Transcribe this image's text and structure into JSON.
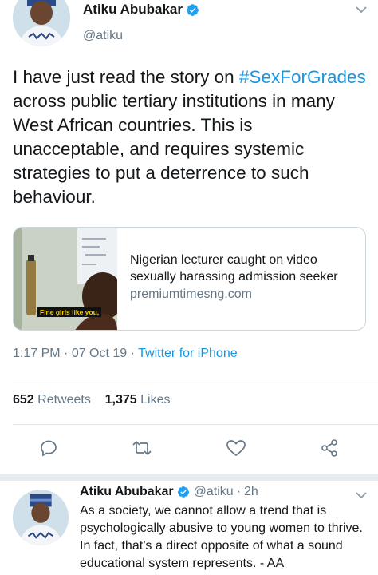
{
  "tweet": {
    "author_name": "Atiku Abubakar",
    "author_handle": "@atiku",
    "text_before": "I have just read the story on ",
    "hashtag": "#SexForGrades",
    "text_after": " across public tertiary institutions in many West African countries. This is unacceptable, and requires systemic strategies to put a deterrence to such behaviour.",
    "card": {
      "image_caption": "Fine girls like you,",
      "title": "Nigerian lecturer caught on video sexually harassing admission seeker",
      "domain": "premiumtimesng.com"
    },
    "time": "1:17 PM",
    "date": "07 Oct 19",
    "dot": " · ",
    "source": "Twitter for iPhone",
    "retweet_count": "652",
    "retweet_label": "Retweets",
    "like_count": "1,375",
    "like_label": "Likes"
  },
  "actions": {
    "icons": [
      "reply-icon",
      "retweet-icon",
      "like-icon",
      "share-icon"
    ]
  },
  "reply": {
    "author_name": "Atiku Abubakar",
    "author_handle": "@atiku",
    "dot": "·",
    "time": "2h",
    "text": "As a society, we cannot allow a trend that is psychologically abusive to young women to thrive. In fact, that’s a direct opposite of what a sound educational system represents. - AA"
  },
  "colors": {
    "link": "#1b95e0",
    "secondary_text": "#657786",
    "verified": "#1da1f2",
    "divider": "#e1e8ed"
  }
}
